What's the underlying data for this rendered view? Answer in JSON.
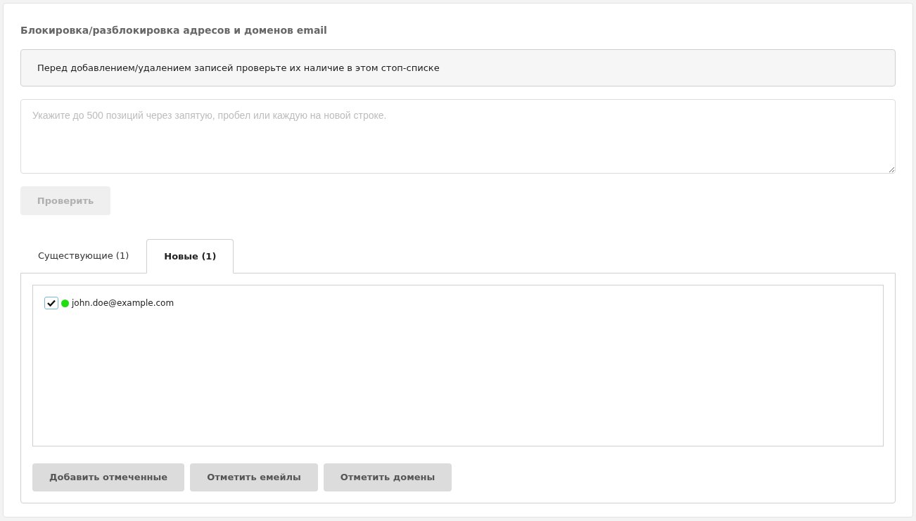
{
  "title": "Блокировка/разблокировка адресов и доменов email",
  "notice": "Перед добавлением/удалением записей проверьте их наличие в этом стоп-списке",
  "input": {
    "placeholder": "Укажите до 500 позиций через запятую, пробел или каждую на новой строке."
  },
  "check_button": {
    "label": "Проверить",
    "disabled": true
  },
  "tabs": [
    {
      "label": "Существующие (1)",
      "selected": false
    },
    {
      "label": "Новые (1)",
      "selected": true
    }
  ],
  "items": [
    {
      "label": "john.doe@example.com",
      "checked": true,
      "color": "#22dd11"
    }
  ],
  "buttons": [
    "Добавить отмеченные",
    "Отметить емейлы",
    "Отметить домены"
  ]
}
